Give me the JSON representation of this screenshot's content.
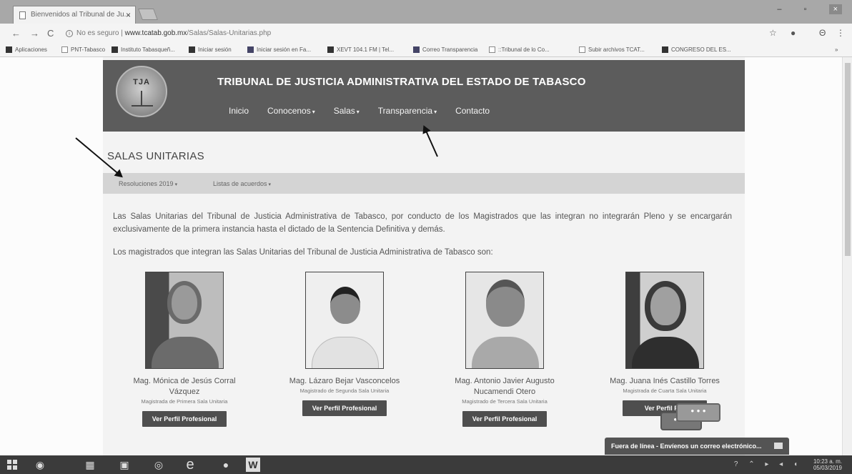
{
  "browser": {
    "tab_title": "Bienvenidos al Tribunal de Ju...",
    "tab_close": "×",
    "window_controls": [
      "–",
      "▫"
    ],
    "window_close": "×",
    "nav": {
      "back": "←",
      "forward": "→",
      "reload": "C"
    },
    "security_label": "No es seguro",
    "url_domain": "www.tcatab.gob.mx",
    "url_path": "/Salas/Salas-Unitarias.php",
    "star": "☆",
    "profile": "Θ",
    "menu": "⋮",
    "bookmarks": [
      "Aplicaciones",
      "PNT-Tabasco",
      "Instituto Tabasqueñ...",
      "Iniciar sesión",
      "Iniciar sesión en Fa...",
      "XEVT 104.1 FM | Tel...",
      "Correo Transparencia",
      "::Tribunal de lo Co...",
      "Subir archivos TCAT...",
      "CONGRESO DEL ES..."
    ],
    "bookmarks_more": "»"
  },
  "site": {
    "logo_text": "TJA",
    "title": "TRIBUNAL DE JUSTICIA ADMINISTRATIVA DEL ESTADO DE TABASCO",
    "nav": [
      "Inicio",
      "Conocenos",
      "Salas",
      "Transparencia",
      "Contacto"
    ],
    "page_title": "SALAS UNITARIAS",
    "subnav": [
      "Resoluciones 2019",
      "Listas de acuerdos"
    ],
    "intro": "Las Salas Unitarias del Tribunal de Justicia Administrativa de Tabasco, por conducto de los Magistrados que las integran no integrarán Pleno y se encargarán exclusivamente de la primera instancia hasta el dictado de la Sentencia Definitiva y demás.",
    "intro2": "Los magistrados que integran las Salas Unitarias del Tribunal de Justicia Administrativa de Tabasco son:",
    "magistrates": [
      {
        "name": "Mag. Mónica de Jesús Corral Vázquez",
        "role": "Magistrada de Primera Sala Unitaria",
        "button": "Ver Perfil Profesional"
      },
      {
        "name": "Mag. Lázaro Bejar Vasconcelos",
        "role": "Magistrado de Segunda Sala Unitaria",
        "button": "Ver Perfil Profesional"
      },
      {
        "name": "Mag. Antonio Javier Augusto Nucamendi Otero",
        "role": "Magistrado de Tercera Sala Unitaria",
        "button": "Ver Perfil Profesional"
      },
      {
        "name": "Mag. Juana Inés Castillo Torres",
        "role": "Magistrada de Cuarta Sala Unitaria",
        "button": "Ver Perfil Pro"
      }
    ],
    "chat_dots": "• • •",
    "offline_label": "Fuera de línea - Envíenos un correo electrónico..."
  },
  "taskbar": {
    "time": "10:23 a. m.",
    "date": "05/03/2019",
    "word_icon": "W",
    "edge_icon": "e"
  }
}
